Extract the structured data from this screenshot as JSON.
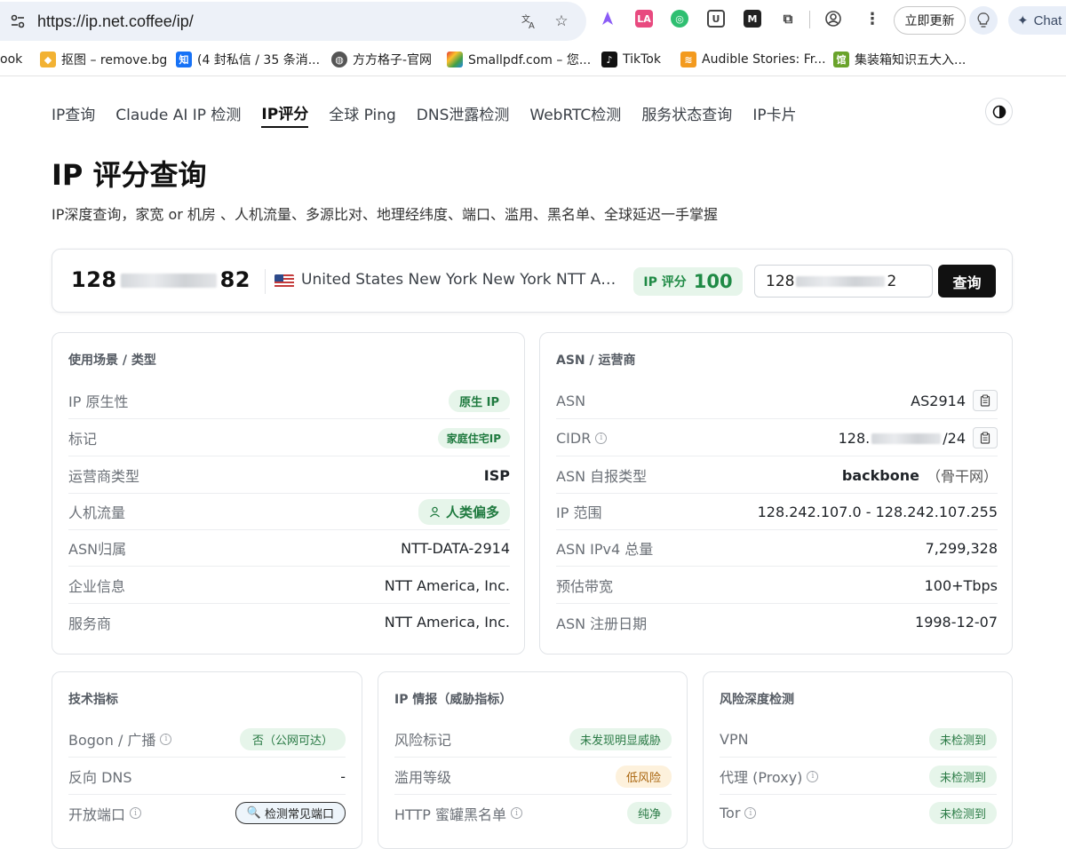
{
  "browser": {
    "url": "https://ip.net.coffee/ip/",
    "update_label": "立即更新",
    "chat_label": "Chat",
    "bookmarks": [
      {
        "label": "ook",
        "icon": "book-icon"
      },
      {
        "label": "抠图 – remove.bg",
        "icon": "removebg-icon"
      },
      {
        "label": "(4 封私信 / 35 条消...",
        "icon": "zhihu-icon"
      },
      {
        "label": "方方格子-官网",
        "icon": "globe-icon"
      },
      {
        "label": "Smallpdf.com – 您...",
        "icon": "smallpdf-icon"
      },
      {
        "label": "TikTok",
        "icon": "tiktok-icon"
      },
      {
        "label": "Audible Stories: Fr...",
        "icon": "audible-icon"
      },
      {
        "label": "集装箱知识五大入...",
        "icon": "container-icon"
      }
    ]
  },
  "nav": {
    "items": [
      "IP查询",
      "Claude AI IP 检测",
      "IP评分",
      "全球 Ping",
      "DNS泄露检测",
      "WebRTC检测",
      "服务状态查询",
      "IP卡片"
    ],
    "active": "IP评分"
  },
  "page": {
    "title": "IP 评分查询",
    "subtitle": "IP深度查询，家宽 or 机房 、人机流量、多源比对、地理经纬度、端口、滥用、黑名单、全球延迟一手掌握"
  },
  "search": {
    "ip_prefix": "128",
    "ip_suffix": "82",
    "location": "United States New York New York NTT America, Inc.",
    "score_label": "IP 评分",
    "score_value": "100",
    "input_prefix": "128",
    "input_suffix": "2",
    "button_label": "查询"
  },
  "usage_card": {
    "title": "使用场景 / 类型",
    "rows": [
      {
        "label": "IP 原生性",
        "value": "原生 IP"
      },
      {
        "label": "标记",
        "value": "家庭住宅IP"
      },
      {
        "label": "运营商类型",
        "value": "ISP"
      },
      {
        "label": "人机流量",
        "value": "人类偏多"
      },
      {
        "label": "ASN归属",
        "value": "NTT-DATA-2914"
      },
      {
        "label": "企业信息",
        "value": "NTT America, Inc."
      },
      {
        "label": "服务商",
        "value": "NTT America, Inc."
      }
    ]
  },
  "asn_card": {
    "title": "ASN / 运营商",
    "rows": [
      {
        "label": "ASN",
        "value": "AS2914"
      },
      {
        "label": "CIDR",
        "value_prefix": "128.",
        "value_suffix": "/24"
      },
      {
        "label": "ASN 自报类型",
        "value": "backbone",
        "note": "（骨干网）"
      },
      {
        "label": "IP 范围",
        "value": "128.242.107.0 - 128.242.107.255"
      },
      {
        "label": "ASN IPv4 总量",
        "value": "7,299,328"
      },
      {
        "label": "预估带宽",
        "value": "100+Tbps"
      },
      {
        "label": "ASN 注册日期",
        "value": "1998-12-07"
      }
    ]
  },
  "tech_card": {
    "title": "技术指标",
    "rows": [
      {
        "label": "Bogon / 广播",
        "value": "否（公网可达）"
      },
      {
        "label": "反向 DNS",
        "value": "-"
      },
      {
        "label": "开放端口",
        "value": "检测常见端口"
      }
    ]
  },
  "intel_card": {
    "title": "IP 情报（威胁指标）",
    "rows": [
      {
        "label": "风险标记",
        "value": "未发现明显威胁"
      },
      {
        "label": "滥用等级",
        "value": "低风险"
      },
      {
        "label": "HTTP 蜜罐黑名单",
        "value": "纯净"
      }
    ]
  },
  "risk_card": {
    "title": "风险深度检测",
    "rows": [
      {
        "label": "VPN",
        "value": "未检测到"
      },
      {
        "label": "代理 (Proxy)",
        "value": "未检测到"
      },
      {
        "label": "Tor",
        "value": "未检测到"
      }
    ]
  },
  "colors": {
    "accent_green": "#1f8a45",
    "badge_green_bg": "#e6f5ea",
    "warn_bg": "#fdf1dc"
  }
}
